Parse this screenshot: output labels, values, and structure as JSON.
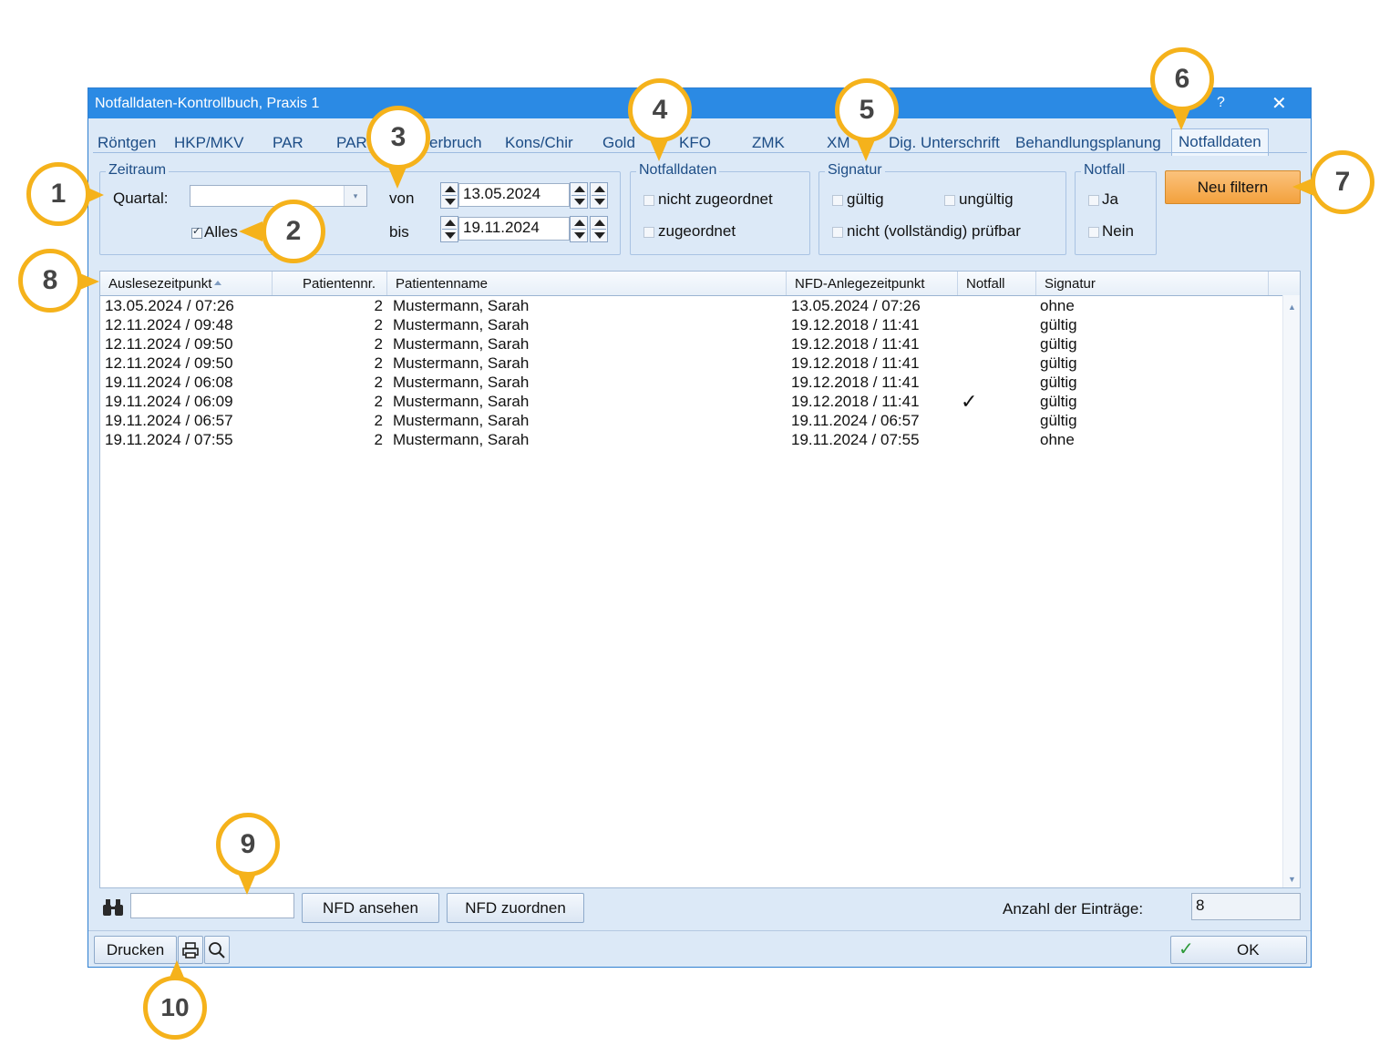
{
  "window": {
    "title": "Notfalldaten-Kontrollbuch, Praxis 1",
    "help": "?",
    "close": "✕"
  },
  "tabs": [
    {
      "label": "Röntgen"
    },
    {
      "label": "HKP/MKV"
    },
    {
      "label": "PAR"
    },
    {
      "label": "PAR"
    },
    {
      "label": "erbruch"
    },
    {
      "label": "Kons/Chir"
    },
    {
      "label": "Gold"
    },
    {
      "label": "KFO"
    },
    {
      "label": "ZMK"
    },
    {
      "label": "XM"
    },
    {
      "label": "Dig. Unterschrift"
    },
    {
      "label": "Behandlungsplanung"
    },
    {
      "label": "Notfalldaten",
      "active": true
    }
  ],
  "zeitraum": {
    "legend": "Zeitraum",
    "quartal_label": "Quartal:",
    "quartal_value": "",
    "alles_label": "Alles",
    "alles_checked": true,
    "von_label": "von",
    "von_value": "13.05.2024",
    "bis_label": "bis",
    "bis_value": "19.11.2024"
  },
  "notfalldaten": {
    "legend": "Notfalldaten",
    "nicht_zugeordnet": "nicht zugeordnet",
    "zugeordnet": "zugeordnet"
  },
  "signatur": {
    "legend": "Signatur",
    "gueltig": "gültig",
    "ungueltig": "ungültig",
    "nicht_pruefbar": "nicht (vollständig) prüfbar"
  },
  "notfall": {
    "legend": "Notfall",
    "ja": "Ja",
    "nein": "Nein"
  },
  "buttons": {
    "neu_filtern": "Neu filtern",
    "nfd_ansehen": "NFD ansehen",
    "nfd_zuordnen": "NFD zuordnen",
    "drucken": "Drucken",
    "ok": "OK"
  },
  "table": {
    "columns": [
      "Auslesezeitpunkt",
      "Patientennr.",
      "Patientenname",
      "NFD-Anlegezeitpunkt",
      "Notfall",
      "Signatur"
    ],
    "rows": [
      {
        "ausl": "13.05.2024 / 07:26",
        "nr": "2",
        "name": "Mustermann, Sarah",
        "nfd": "13.05.2024 / 07:26",
        "notfall": "",
        "sig": "ohne"
      },
      {
        "ausl": "12.11.2024 / 09:48",
        "nr": "2",
        "name": "Mustermann, Sarah",
        "nfd": "19.12.2018 / 11:41",
        "notfall": "",
        "sig": "gültig"
      },
      {
        "ausl": "12.11.2024 / 09:50",
        "nr": "2",
        "name": "Mustermann, Sarah",
        "nfd": "19.12.2018 / 11:41",
        "notfall": "",
        "sig": "gültig"
      },
      {
        "ausl": "12.11.2024 / 09:50",
        "nr": "2",
        "name": "Mustermann, Sarah",
        "nfd": "19.12.2018 / 11:41",
        "notfall": "",
        "sig": "gültig"
      },
      {
        "ausl": "19.11.2024 / 06:08",
        "nr": "2",
        "name": "Mustermann, Sarah",
        "nfd": "19.12.2018 / 11:41",
        "notfall": "",
        "sig": "gültig"
      },
      {
        "ausl": "19.11.2024 / 06:09",
        "nr": "2",
        "name": "Mustermann, Sarah",
        "nfd": "19.12.2018 / 11:41",
        "notfall": "✓",
        "sig": "gültig"
      },
      {
        "ausl": "19.11.2024 / 06:57",
        "nr": "2",
        "name": "Mustermann, Sarah",
        "nfd": "19.11.2024 / 06:57",
        "notfall": "",
        "sig": "gültig"
      },
      {
        "ausl": "19.11.2024 / 07:55",
        "nr": "2",
        "name": "Mustermann, Sarah",
        "nfd": "19.11.2024 / 07:55",
        "notfall": "",
        "sig": "ohne"
      }
    ]
  },
  "footer": {
    "search_value": "",
    "anzahl_label": "Anzahl der Einträge:",
    "anzahl_value": "8"
  },
  "callouts": [
    "1",
    "2",
    "3",
    "4",
    "5",
    "6",
    "7",
    "8",
    "9",
    "10"
  ],
  "colors": {
    "accent": "#f5b21b",
    "titlebar": "#2b8ae4",
    "window_bg": "#dce9f7",
    "filter_button": "#f3a13d"
  }
}
